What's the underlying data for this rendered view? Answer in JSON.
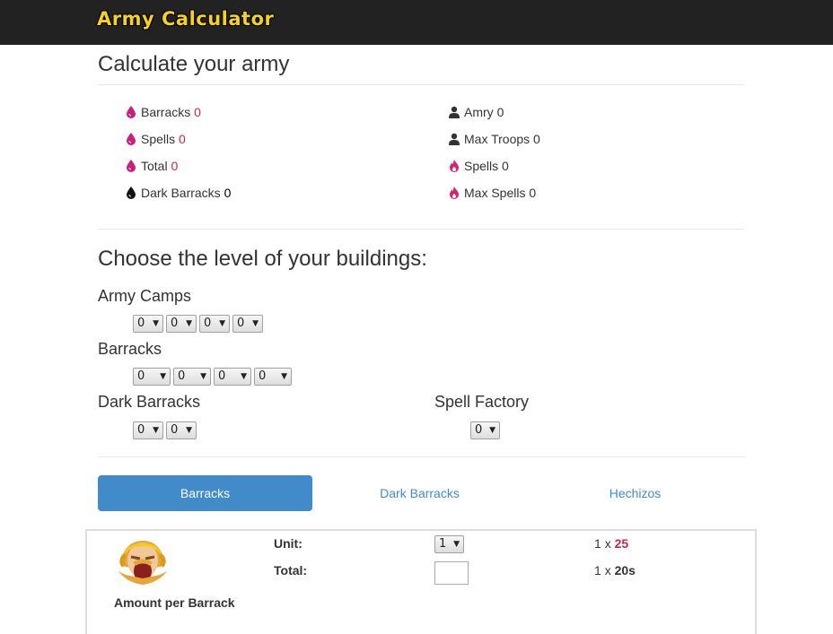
{
  "app": {
    "brand": "Army Calculator",
    "title": "Calculate your army"
  },
  "summary": {
    "left": [
      {
        "label": "Barracks",
        "value": "0"
      },
      {
        "label": "Spells",
        "value": "0"
      },
      {
        "label": "Total",
        "value": "0"
      },
      {
        "label": "Dark Barracks",
        "value": "0"
      }
    ],
    "right": [
      {
        "label": "Amry",
        "value": "0"
      },
      {
        "label": "Max Troops",
        "value": "0"
      },
      {
        "label": "Spells",
        "value": "0"
      },
      {
        "label": "Max Spells",
        "value": "0"
      }
    ]
  },
  "buildings": {
    "heading": "Choose the level of your buildings:",
    "army_camps": {
      "label": "Army Camps",
      "levels": [
        "0",
        "0",
        "0",
        "0"
      ]
    },
    "barracks": {
      "label": "Barracks",
      "levels": [
        "0",
        "0",
        "0",
        "0"
      ]
    },
    "dark_barracks": {
      "label": "Dark Barracks",
      "levels": [
        "0",
        "0"
      ]
    },
    "spell_factory": {
      "label": "Spell Factory",
      "levels": [
        "0"
      ]
    }
  },
  "tabs": {
    "active": "Barracks",
    "items": [
      "Barracks",
      "Dark Barracks",
      "Hechizos"
    ]
  },
  "unit_panel": {
    "caption": "Amount per Barrack",
    "unit_label": "Unit:",
    "total_label": "Total:",
    "unit_value": "1",
    "row1": {
      "count": "1",
      "sep": "x",
      "value": "25"
    },
    "row2": {
      "count": "1",
      "sep": "x",
      "value": "20s"
    }
  },
  "colors": {
    "accent": "#428bca",
    "brand": "#f5d21f",
    "highlight": "#c7254e",
    "navbar": "#222222"
  },
  "icons": {
    "elixir": "elixir-drop-icon",
    "dark_elixir": "dark-elixir-drop-icon",
    "troops": "user-icon",
    "spells": "fire-icon"
  }
}
